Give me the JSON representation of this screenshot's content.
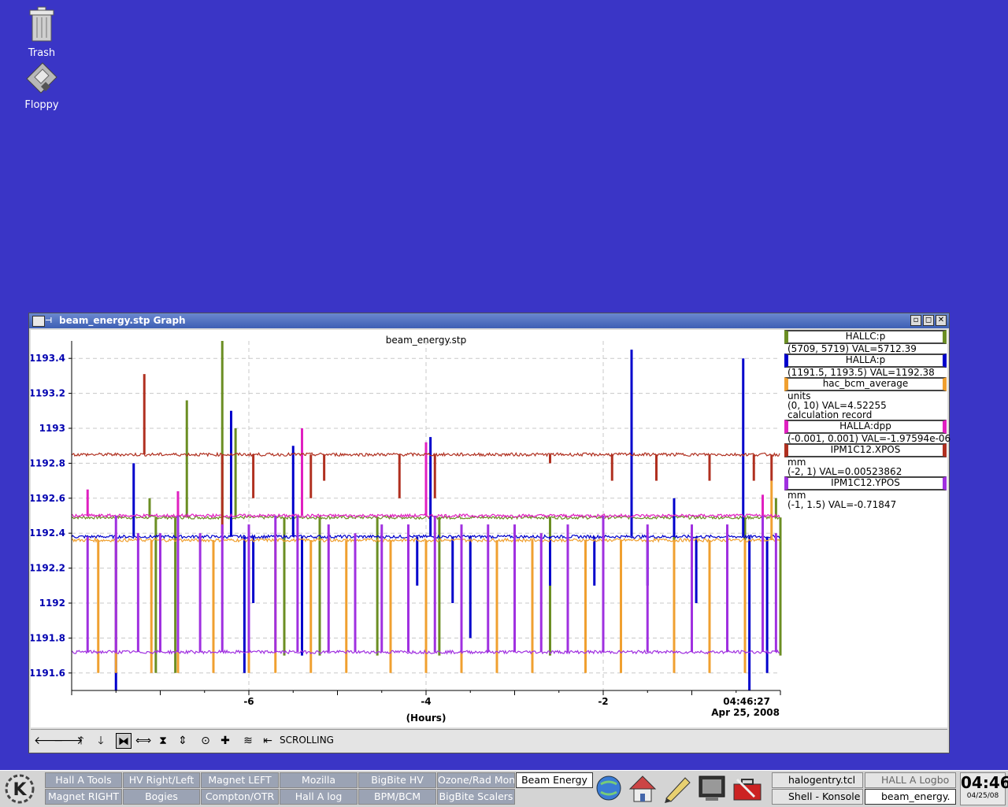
{
  "desktop": {
    "icons": [
      {
        "label": "Trash"
      },
      {
        "label": "Floppy"
      }
    ]
  },
  "window": {
    "title": "beam_energy.stp Graph",
    "buttons": [
      "▫",
      "◻",
      "✕"
    ]
  },
  "plot": {
    "title": "beam_energy.stp",
    "xlabel": "(Hours)",
    "time_label": "04:46:27",
    "date_label": "Apr 25, 2008"
  },
  "chart_data": {
    "type": "line",
    "title": "beam_energy.stp",
    "xlabel": "(Hours)",
    "ylabel": "",
    "xlim": [
      -8,
      0
    ],
    "ylim": [
      1191.5,
      1193.5
    ],
    "x_ticks": [
      -6,
      -4,
      -2
    ],
    "y_ticks": [
      1191.6,
      1191.8,
      1192,
      1192.2,
      1192.4,
      1192.6,
      1192.8,
      1193,
      1193.2,
      1193.4
    ],
    "y_tick_labels": [
      "1191.6",
      "1191.8",
      "1192",
      "1192.2",
      "1192.4",
      "1192.6",
      "1192.8",
      "1193",
      "1193.2",
      "1193.4"
    ],
    "grid": true,
    "legend_position": "right",
    "series": [
      {
        "name": "HALLC:p",
        "color": "#6b8e23",
        "base": 1192.49,
        "spikes": [
          [
            -7.12,
            1192.6
          ],
          [
            -7.05,
            1191.6
          ],
          [
            -6.83,
            1191.6
          ],
          [
            -6.7,
            1193.16
          ],
          [
            -6.3,
            1193.5
          ],
          [
            -6.15,
            1193.0
          ],
          [
            -5.6,
            1191.7
          ],
          [
            -5.2,
            1191.7
          ],
          [
            -4.55,
            1191.7
          ],
          [
            -3.85,
            1191.7
          ],
          [
            -2.6,
            1191.7
          ],
          [
            -1.2,
            1191.7
          ],
          [
            -0.4,
            1191.7
          ],
          [
            -0.05,
            1192.6
          ],
          [
            0.0,
            1191.7
          ]
        ]
      },
      {
        "name": "HALLA:p",
        "color": "#0000cc",
        "base": 1192.38,
        "spikes": [
          [
            -7.5,
            1191.5
          ],
          [
            -7.3,
            1192.8
          ],
          [
            -6.2,
            1193.1
          ],
          [
            -6.05,
            1191.6
          ],
          [
            -5.95,
            1192.0
          ],
          [
            -5.5,
            1192.9
          ],
          [
            -5.4,
            1191.7
          ],
          [
            -4.1,
            1192.1
          ],
          [
            -3.95,
            1192.95
          ],
          [
            -3.7,
            1192.0
          ],
          [
            -3.5,
            1191.8
          ],
          [
            -2.6,
            1192.1
          ],
          [
            -2.1,
            1192.1
          ],
          [
            -1.68,
            1193.45
          ],
          [
            -1.5,
            1192.1
          ],
          [
            -1.2,
            1192.6
          ],
          [
            -0.95,
            1192.0
          ],
          [
            -0.42,
            1193.4
          ],
          [
            -0.35,
            1191.5
          ],
          [
            -0.15,
            1191.6
          ]
        ]
      },
      {
        "name": "hac_bcm_average",
        "color": "#f0a030",
        "base": 1192.36,
        "spikes": [
          [
            -7.7,
            1191.6
          ],
          [
            -7.5,
            1191.6
          ],
          [
            -7.1,
            1191.6
          ],
          [
            -6.8,
            1191.6
          ],
          [
            -6.4,
            1191.6
          ],
          [
            -6.0,
            1191.6
          ],
          [
            -5.7,
            1191.6
          ],
          [
            -5.3,
            1191.6
          ],
          [
            -4.9,
            1191.6
          ],
          [
            -4.4,
            1191.6
          ],
          [
            -4.0,
            1191.6
          ],
          [
            -3.6,
            1191.6
          ],
          [
            -3.2,
            1191.6
          ],
          [
            -2.8,
            1191.6
          ],
          [
            -2.2,
            1191.6
          ],
          [
            -1.8,
            1191.6
          ],
          [
            -1.2,
            1191.6
          ],
          [
            -0.8,
            1191.6
          ],
          [
            -0.4,
            1191.6
          ],
          [
            -0.1,
            1192.7
          ]
        ]
      },
      {
        "name": "HALLA:dpp",
        "color": "#e020c0",
        "base": 1192.5,
        "spikes": [
          [
            -7.82,
            1192.65
          ],
          [
            -6.8,
            1192.64
          ],
          [
            -5.4,
            1193.0
          ],
          [
            -4.0,
            1192.92
          ],
          [
            -2.4,
            1192.5
          ],
          [
            -0.2,
            1192.62
          ]
        ]
      },
      {
        "name": "IPM1C12.XPOS",
        "color": "#b03020",
        "base": 1192.85,
        "spikes": [
          [
            -7.18,
            1193.31
          ],
          [
            -6.3,
            1192.4
          ],
          [
            -5.95,
            1192.6
          ],
          [
            -5.3,
            1192.6
          ],
          [
            -5.15,
            1192.7
          ],
          [
            -4.3,
            1192.6
          ],
          [
            -3.9,
            1192.6
          ],
          [
            -2.6,
            1192.8
          ],
          [
            -1.9,
            1192.7
          ],
          [
            -1.4,
            1192.7
          ],
          [
            -0.8,
            1192.7
          ],
          [
            -0.3,
            1192.7
          ],
          [
            -0.1,
            1192.7
          ]
        ]
      },
      {
        "name": "IPM1C12.YPOS",
        "color": "#a030e0",
        "base": 1191.72,
        "spikes": [
          [
            -7.82,
            1192.38
          ],
          [
            -7.5,
            1192.5
          ],
          [
            -7.25,
            1192.4
          ],
          [
            -7.0,
            1192.4
          ],
          [
            -6.8,
            1192.5
          ],
          [
            -6.55,
            1192.4
          ],
          [
            -6.3,
            1192.45
          ],
          [
            -6.0,
            1192.45
          ],
          [
            -5.7,
            1192.5
          ],
          [
            -5.45,
            1192.5
          ],
          [
            -5.1,
            1192.45
          ],
          [
            -4.8,
            1192.4
          ],
          [
            -4.5,
            1192.45
          ],
          [
            -4.2,
            1192.45
          ],
          [
            -3.9,
            1192.5
          ],
          [
            -3.6,
            1192.45
          ],
          [
            -3.3,
            1192.45
          ],
          [
            -3.0,
            1192.45
          ],
          [
            -2.7,
            1192.4
          ],
          [
            -2.4,
            1192.45
          ],
          [
            -2.0,
            1192.5
          ],
          [
            -1.5,
            1192.45
          ],
          [
            -1.0,
            1192.45
          ],
          [
            -0.6,
            1192.45
          ],
          [
            -0.2,
            1192.5
          ],
          [
            -0.05,
            1192.4
          ]
        ]
      }
    ]
  },
  "legend": [
    {
      "name": "HALLC:p",
      "color": "#6b8e23",
      "lines": [
        "(5709, 5719) VAL=5712.39"
      ]
    },
    {
      "name": "HALLA:p",
      "color": "#0000cc",
      "lines": [
        "(1191.5, 1193.5) VAL=1192.38"
      ]
    },
    {
      "name": "hac_bcm_average",
      "color": "#f0a030",
      "lines": [
        "units",
        "(0, 10) VAL=4.52255",
        "calculation record"
      ]
    },
    {
      "name": "HALLA:dpp",
      "color": "#e020c0",
      "lines": [
        "(-0.001, 0.001) VAL=-1.97594e-06"
      ]
    },
    {
      "name": "IPM1C12.XPOS",
      "color": "#b03020",
      "lines": [
        "mm",
        "(-2, 1) VAL=0.00523862"
      ]
    },
    {
      "name": "IPM1C12.YPOS",
      "color": "#a030e0",
      "lines": [
        "mm",
        "(-1, 1.5) VAL=-0.71847"
      ]
    }
  ],
  "toolbar": {
    "status_label": "SCROLLING"
  },
  "taskbar": {
    "row1": [
      "Hall A Tools",
      "HV Right/Left",
      "Magnet LEFT",
      "Mozilla",
      "BigBite HV",
      "Ozone/Rad Mon",
      "Beam Energy"
    ],
    "row2": [
      "Magnet RIGHT",
      "Bogies",
      "Compton/OTR",
      "Hall A log",
      "BPM/BCM",
      "BigBite Scalers"
    ],
    "tasks_top": [
      "halogentry.tcl",
      "HALL A Logbo"
    ],
    "tasks_bottom": [
      "Shell - Konsole",
      "beam_energy."
    ],
    "clock_time": "04:46",
    "clock_date": "04/25/08"
  }
}
